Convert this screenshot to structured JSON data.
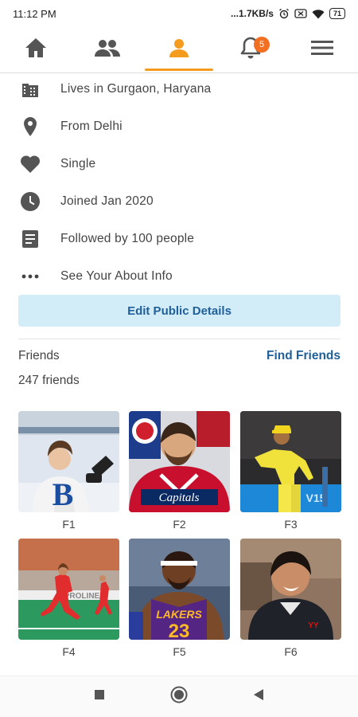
{
  "status": {
    "time": "11:12 PM",
    "net_speed": "...1.7KB/s",
    "battery": "71"
  },
  "nav": {
    "notification_count": "5"
  },
  "about": {
    "items": [
      {
        "icon": "building-icon",
        "text": "Lives in Gurgaon, Haryana"
      },
      {
        "icon": "location-pin-icon",
        "text": "From Delhi"
      },
      {
        "icon": "heart-icon",
        "text": "Single"
      },
      {
        "icon": "clock-icon",
        "text": "Joined Jan 2020"
      },
      {
        "icon": "document-icon",
        "text": "Followed by 100 people"
      },
      {
        "icon": "more-dots-icon",
        "text": "See Your About Info"
      }
    ],
    "edit_button": "Edit Public Details"
  },
  "friends": {
    "title": "Friends",
    "find_link": "Find Friends",
    "count": "247 friends",
    "list": [
      {
        "name": "F1"
      },
      {
        "name": "F2"
      },
      {
        "name": "F3"
      },
      {
        "name": "F4"
      },
      {
        "name": "F5"
      },
      {
        "name": "F6"
      }
    ]
  },
  "colors": {
    "accent": "#f39c1f",
    "badge": "#f36f21",
    "link": "#1f5f9a",
    "button_bg": "#d2ecf8"
  }
}
